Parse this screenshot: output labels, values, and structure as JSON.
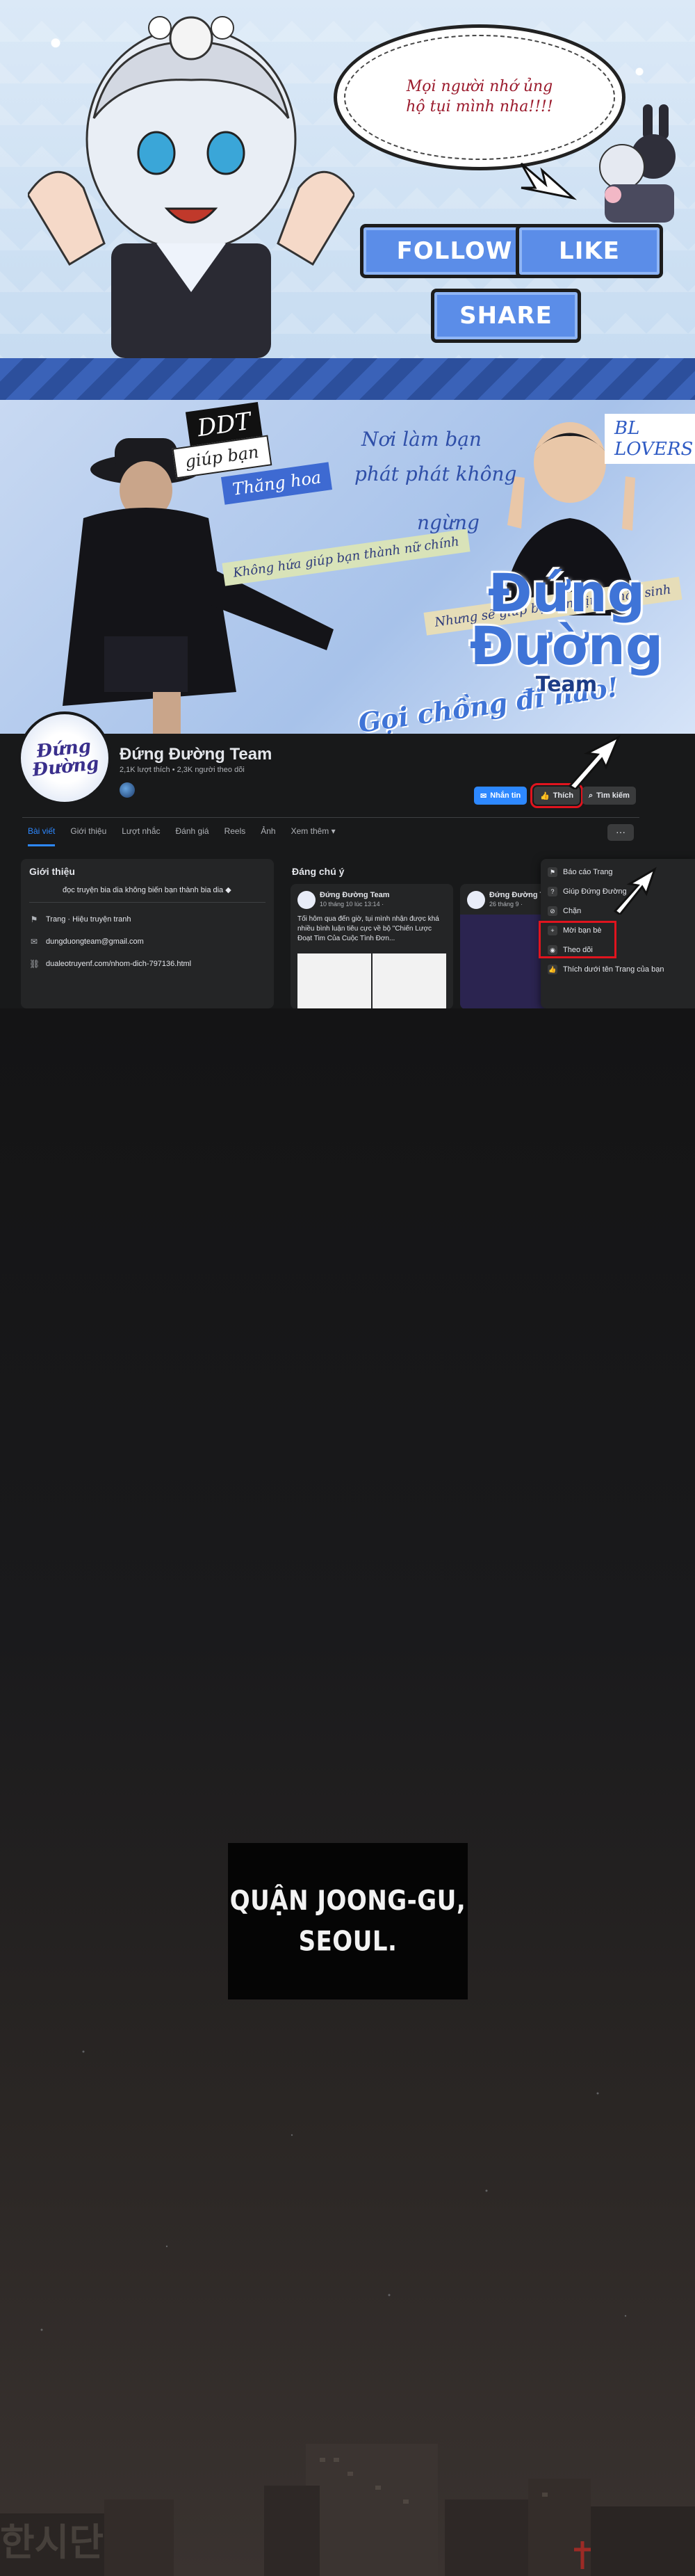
{
  "promo": {
    "speech_text": "Mọi người nhớ ủng hộ tụi mình nha!!!!",
    "follow_label": "FOLLOW",
    "like_label": "LIKE",
    "share_label": "SHARE"
  },
  "cover": {
    "tag_ddt": "DDT",
    "tag_giupban": "giúp bạn",
    "tag_thanghoa": "Thăng hoa",
    "tag_khonghua": "Không hứa giúp bạn thành nữ chính",
    "tag_nhungso": "Nhưng sẽ giúp bạn ổn định nhân sinh",
    "script_1": "Nơi làm bạn",
    "script_2": "phát phát không",
    "script_3": "ngừng",
    "tag_goichong": "Gọi chồng đi nào!",
    "tag_bl": "BL LOVERS",
    "title_line1": "Đứng Đường",
    "title_line2": "Team"
  },
  "page": {
    "avatar_text": "Đứng Đường",
    "name": "Đứng Đường Team",
    "stats": "2,1K lượt thích • 2,3K người theo dõi",
    "btn_message": "Nhắn tin",
    "btn_like": "Thích",
    "btn_search": "Tìm kiếm",
    "more": "···",
    "tabs": [
      "Bài viết",
      "Giới thiệu",
      "Lượt nhắc",
      "Đánh giá",
      "Reels",
      "Ảnh",
      "Xem thêm ▾"
    ]
  },
  "intro": {
    "title": "Giới thiệu",
    "desc": "đọc truyện bia dia không biến bạn thành bia dia ◆",
    "category": "Trang · Hiệu truyện tranh",
    "email": "dungduongteam@gmail.com",
    "website": "dualeotruyenf.com/nhom-dich-797136.html"
  },
  "featured": {
    "title": "Đáng chú ý",
    "post1": {
      "name": "Đứng Đường Team",
      "date": "10 tháng 10 lúc 13:14 ·",
      "text": "Tối hôm qua đến giờ, tụi mình nhận được khá nhiều bình luận tiêu cực về bộ \"Chiến Lược Đoạt Tim Của Cuộc Tình Đơn..."
    },
    "post2": {
      "name": "Đứng Đường Team",
      "date": "26 tháng 9 ·"
    }
  },
  "menu": {
    "items": [
      "Báo cáo Trang",
      "Giúp Đứng Đường",
      "Chặn",
      "Mời bạn bè",
      "Theo dõi",
      "Thích dưới tên Trang của bạn"
    ]
  },
  "panel": {
    "caption": "QUẬN JOONG-GU, SEOUL.",
    "sign": "한시단"
  }
}
